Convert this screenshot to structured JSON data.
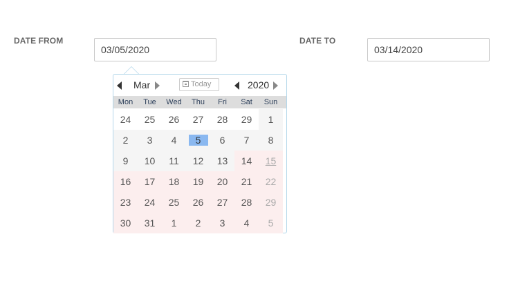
{
  "date_from": {
    "label": "DATE FROM",
    "value": "03/05/2020"
  },
  "date_to": {
    "label": "DATE TO",
    "value": "03/14/2020"
  },
  "calendar": {
    "month": "Mar",
    "year": "2020",
    "today_label": "Today",
    "weekdays": [
      "Mon",
      "Tue",
      "Wed",
      "Thu",
      "Fri",
      "Sat",
      "Sun"
    ],
    "weeks": [
      [
        "24",
        "25",
        "26",
        "27",
        "28",
        "29",
        "1"
      ],
      [
        "2",
        "3",
        "4",
        "5",
        "6",
        "7",
        "8"
      ],
      [
        "9",
        "10",
        "11",
        "12",
        "13",
        "14",
        "15"
      ],
      [
        "16",
        "17",
        "18",
        "19",
        "20",
        "21",
        "22"
      ],
      [
        "23",
        "24",
        "25",
        "26",
        "27",
        "28",
        "29"
      ],
      [
        "30",
        "31",
        "1",
        "2",
        "3",
        "4",
        "5"
      ]
    ],
    "selected_day": "5",
    "range_end_day": "14",
    "today_day": "15"
  },
  "colors": {
    "selected": "#8ab8f0",
    "range_tint": "#fceeee",
    "border_accent": "#b3d7ea"
  }
}
